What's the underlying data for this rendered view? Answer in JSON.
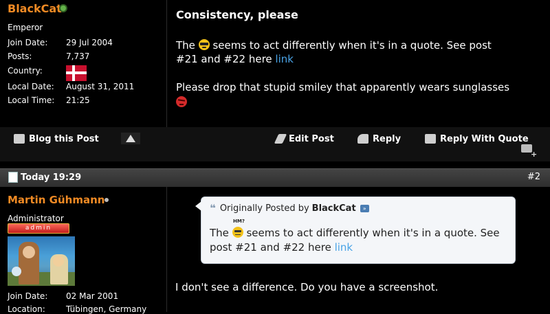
{
  "post1": {
    "author": {
      "name": "BlackCat",
      "title": "Emperor",
      "online_color": "#63b24a",
      "info": [
        {
          "label": "Join Date:",
          "value": "29 Jul 2004"
        },
        {
          "label": "Posts:",
          "value": "7,737"
        },
        {
          "label": "Country:",
          "value": ""
        },
        {
          "label": "Local Date:",
          "value": "August 31, 2011"
        },
        {
          "label": "Local Time:",
          "value": "21:25"
        }
      ],
      "country_flag": "denmark-flag"
    },
    "title": "Consistency, please",
    "message": {
      "line1_a": "The",
      "line1_b": "seems to act differently when it's in a quote. See post",
      "line2_a": "#21 and #22 here",
      "link": "link",
      "line3": "Please drop that stupid smiley that apparently wears sunglasses"
    }
  },
  "actions": {
    "blog": "Blog this Post",
    "edit": "Edit Post",
    "reply": "Reply",
    "reply_quote": "Reply With Quote"
  },
  "post2": {
    "date": "Today 19:29",
    "number": "#2",
    "author": {
      "name": "Martin Gühmann",
      "title": "Administrator",
      "rank": "admin",
      "info": [
        {
          "label": "Join Date:",
          "value": "02 Mar 2001"
        },
        {
          "label": "Location:",
          "value": "Tübingen, Germany"
        }
      ]
    },
    "quote": {
      "prefix": "Originally Posted by",
      "author": "BlackCat",
      "smiley_caption": "HM?",
      "line_a": "The",
      "line_b": "seems to act differently when it's in a quote. See",
      "line_c": "post #21 and #22 here",
      "link": "link"
    },
    "message": "I don't see a difference. Do you have a screenshot."
  },
  "colors": {
    "username": "#f08a24",
    "link": "#4aa3e6"
  }
}
